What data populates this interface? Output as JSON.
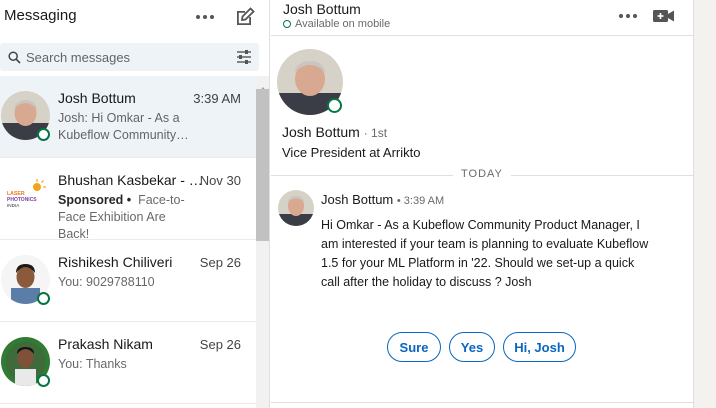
{
  "left": {
    "title": "Messaging",
    "search_placeholder": "Search messages"
  },
  "conversations": [
    {
      "name": "Josh Bottum",
      "date": "3:39 AM",
      "snippet": "Josh: Hi Omkar - As a Kubeflow Community…",
      "online": true,
      "active": true
    },
    {
      "name": "Bhushan Kasbekar - …",
      "date": "Nov 30",
      "sponsored_label": "Sponsored •",
      "snippet": "Face-to-Face Exhibition Are Back!",
      "logo_lines": [
        "LASER",
        "PHOTONICS",
        "INDIA"
      ],
      "online": false
    },
    {
      "name": "Rishikesh Chiliveri",
      "date": "Sep 26",
      "snippet": "You: 9029788110",
      "online": true
    },
    {
      "name": "Prakash Nikam",
      "date": "Sep 26",
      "snippet": "You: Thanks",
      "online": true
    }
  ],
  "thread": {
    "header_name": "Josh Bottum",
    "header_status": "Available on mobile",
    "profile_name": "Josh Bottum",
    "profile_degree": "· 1st",
    "profile_title": "Vice President at Arrikto",
    "divider": "TODAY",
    "message_sender": "Josh Bottum",
    "message_time": "• 3:39 AM",
    "message_body": "Hi Omkar - As a Kubeflow Community Product Manager, I am interested if your team is planning to evaluate Kubeflow 1.5 for your ML Platform in '22. Should we set-up a quick call after the holiday to discuss ? Josh",
    "replies": [
      "Sure",
      "Yes",
      "Hi, Josh"
    ]
  },
  "colors": {
    "accent": "#0a66c2",
    "online": "#057642",
    "active_row": "#eef3f8"
  }
}
